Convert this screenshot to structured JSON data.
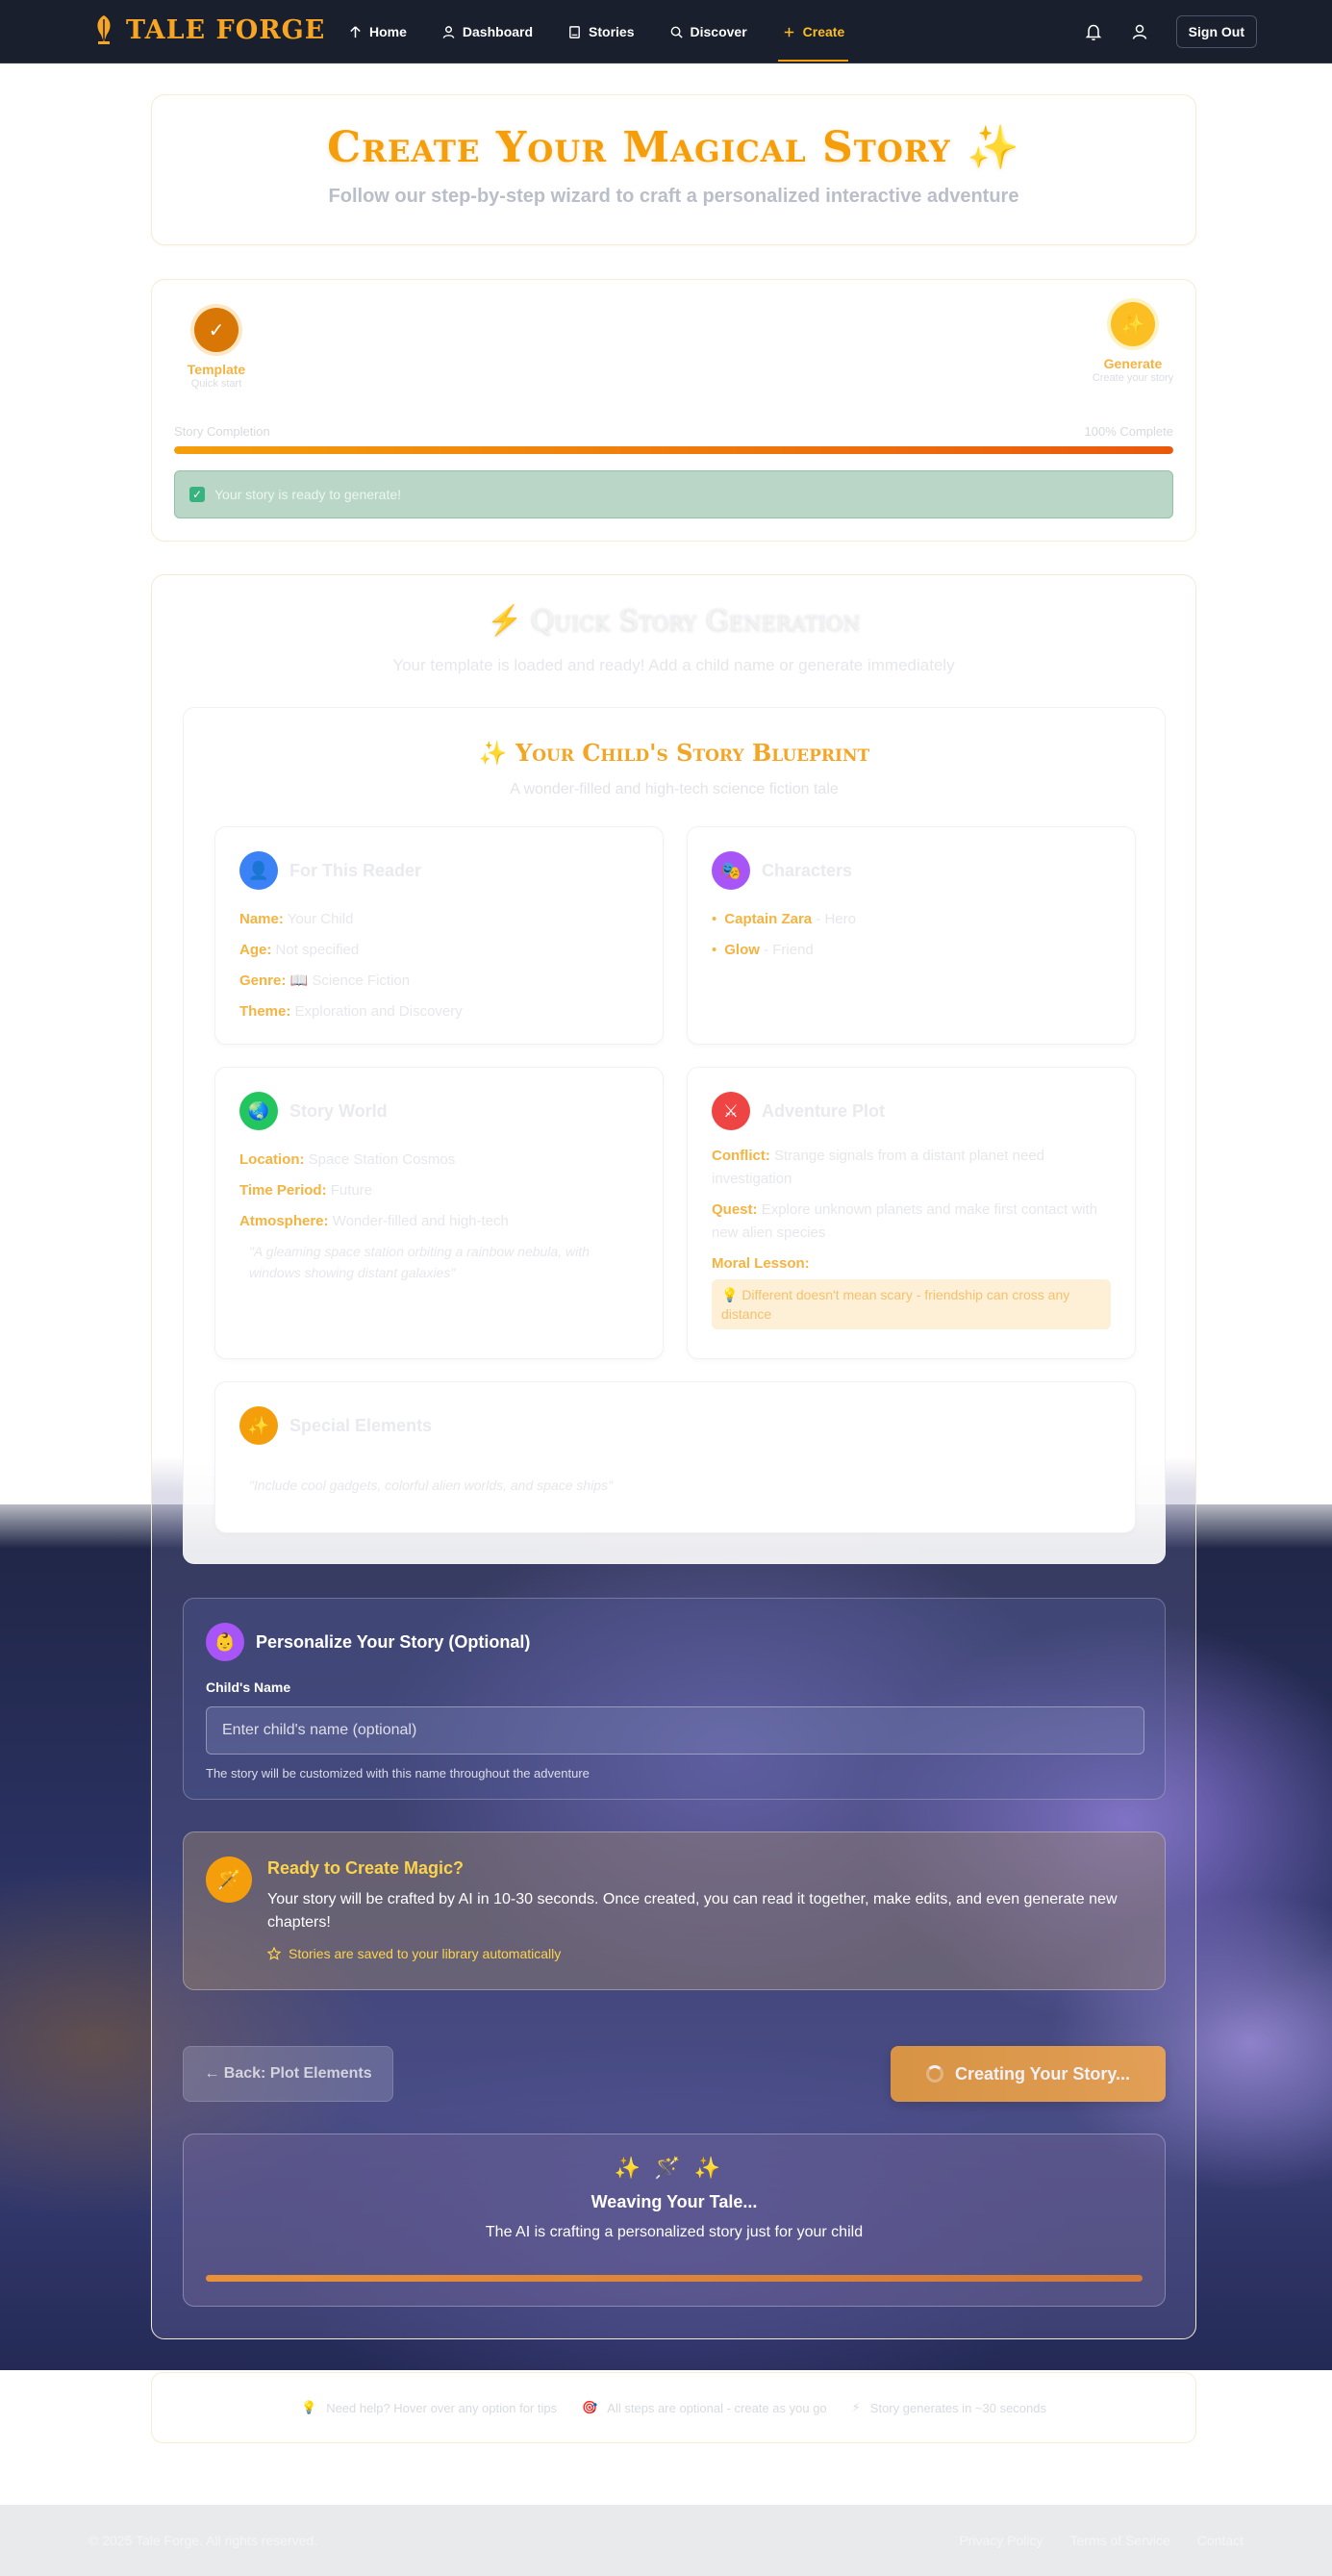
{
  "nav": {
    "brand": "TALE FORGE",
    "links": [
      {
        "label": "Home",
        "icon": "home-icon"
      },
      {
        "label": "Dashboard",
        "icon": "user-icon"
      },
      {
        "label": "Stories",
        "icon": "book-icon"
      },
      {
        "label": "Discover",
        "icon": "search-icon"
      },
      {
        "label": "Create",
        "icon": "plus-icon",
        "active": true
      }
    ],
    "sign_out": "Sign Out"
  },
  "hero": {
    "title": "Create Your Magical Story",
    "title_emoji": "✨",
    "subtitle": "Follow our step-by-step wizard to craft a personalized interactive adventure"
  },
  "progress": {
    "steps": [
      {
        "label": "Template",
        "desc": "Quick start",
        "symbol": "✓"
      },
      {
        "label": "Generate",
        "desc": "Create your story",
        "symbol": "✨"
      }
    ],
    "completion_label": "Story Completion",
    "completion_text": "100% Complete",
    "completion_fraction": 1.0,
    "ready_text": "Your story is ready to generate!"
  },
  "quick": {
    "title": "Quick Story Generation",
    "subtitle": "Your template is loaded and ready! Add a child name or generate immediately"
  },
  "blueprint": {
    "title": "Your Child's Story Blueprint",
    "subtitle": "A wonder-filled and high-tech science fiction tale",
    "reader": {
      "title": "For This Reader",
      "name_k": "Name:",
      "name_v": "Your Child",
      "age_k": "Age:",
      "age_v": "Not specified",
      "genre_k": "Genre:",
      "genre_v": "📖 Science Fiction",
      "theme_k": "Theme:",
      "theme_v": "Exploration and Discovery"
    },
    "characters": {
      "title": "Characters",
      "items": [
        {
          "name": "Captain Zara",
          "role": "- Hero"
        },
        {
          "name": "Glow",
          "role": "- Friend"
        }
      ]
    },
    "world": {
      "title": "Story World",
      "location_k": "Location:",
      "location_v": "Space Station Cosmos",
      "period_k": "Time Period:",
      "period_v": "Future",
      "atmos_k": "Atmosphere:",
      "atmos_v": "Wonder-filled and high-tech",
      "quote": "\"A gleaming space station orbiting a rainbow nebula, with windows showing distant galaxies\""
    },
    "plot": {
      "title": "Adventure Plot",
      "conflict_k": "Conflict:",
      "conflict_v": "Strange signals from a distant planet need investigation",
      "quest_k": "Quest:",
      "quest_v": "Explore unknown planets and make first contact with new alien species",
      "lesson_k": "Moral Lesson:",
      "lesson_v": "💡 Different doesn't mean scary - friendship can cross any distance"
    },
    "special": {
      "title": "Special Elements",
      "quote": "\"Include cool gadgets, colorful alien worlds, and space ships\""
    }
  },
  "personalize": {
    "title": "Personalize Your Story (Optional)",
    "label": "Child's Name",
    "placeholder": "Enter child's name (optional)",
    "value": "",
    "hint": "The story will be customized with this name throughout the adventure"
  },
  "magic": {
    "title": "Ready to Create Magic?",
    "text": "Your story will be crafted by AI in 10-30 seconds. Once created, you can read it together, make edits, and even generate new chapters!",
    "note": "Stories are saved to your library automatically"
  },
  "buttons": {
    "back": "← Back: Plot Elements",
    "create": "Creating Your Story..."
  },
  "weaving": {
    "icons": "✨🪄✨",
    "title": "Weaving Your Tale...",
    "subtitle": "The AI is crafting a personalized story just for your child"
  },
  "tips": [
    {
      "icon": "💡",
      "text": "Need help? Hover over any option for tips"
    },
    {
      "icon": "🎯",
      "text": "All steps are optional - create as you go"
    },
    {
      "icon": "⚡",
      "text": "Story generates in ~30 seconds"
    }
  ],
  "footer": {
    "copyright": "© 2025 Tale Forge. All rights reserved.",
    "links": [
      "Privacy Policy",
      "Terms of Service",
      "Contact"
    ]
  },
  "colors": {
    "brand": "#f6a623",
    "nav_bg": "#1a1f2e",
    "accent": "#f59e0b"
  }
}
